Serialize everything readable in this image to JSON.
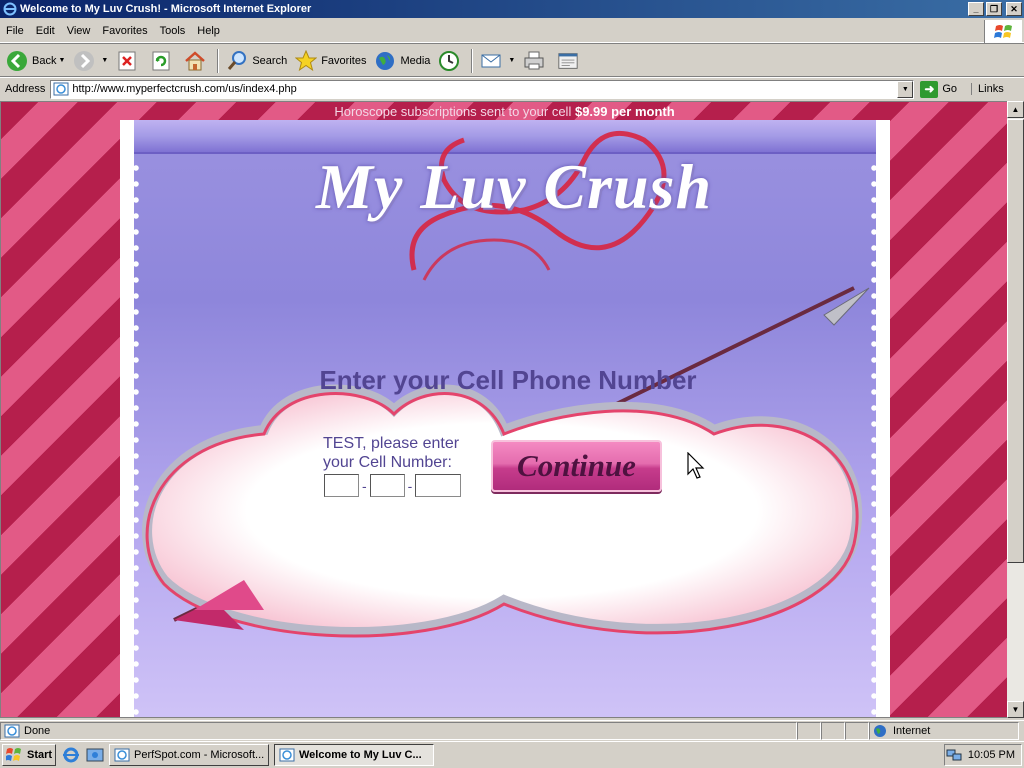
{
  "window": {
    "title": "Welcome to My Luv Crush! - Microsoft Internet Explorer",
    "buttons": [
      "_",
      "❐",
      "✕"
    ]
  },
  "menu": [
    {
      "label": "File"
    },
    {
      "label": "Edit"
    },
    {
      "label": "View"
    },
    {
      "label": "Favorites"
    },
    {
      "label": "Tools"
    },
    {
      "label": "Help"
    }
  ],
  "toolbar": {
    "back": "Back",
    "search": "Search",
    "favorites": "Favorites",
    "media": "Media"
  },
  "address": {
    "label": "Address",
    "url": "http://www.myperfectcrush.com/us/index4.php",
    "go": "Go",
    "links": "Links"
  },
  "page": {
    "promo_text": "Horoscope subscriptions sent to your cell",
    "promo_price": "$9.99 per month",
    "logo": "My Luv Crush",
    "form_title": "Enter your Cell Phone Number",
    "form_label": "TEST, please enter your Cell Number:",
    "phone_sep": "-",
    "continue": "Continue"
  },
  "status": {
    "text": "Done",
    "zone": "Internet"
  },
  "taskbar": {
    "start": "Start",
    "tasks": [
      {
        "label": "PerfSpot.com - Microsoft..."
      },
      {
        "label": "Welcome to My Luv C..."
      }
    ],
    "clock": "10:05 PM"
  },
  "colors": {
    "stripe_dark": "#b51f4c",
    "stripe_light": "#e25a86",
    "heading": "#524592",
    "button": "#e46cae",
    "heart_outline": "#e4446c"
  }
}
